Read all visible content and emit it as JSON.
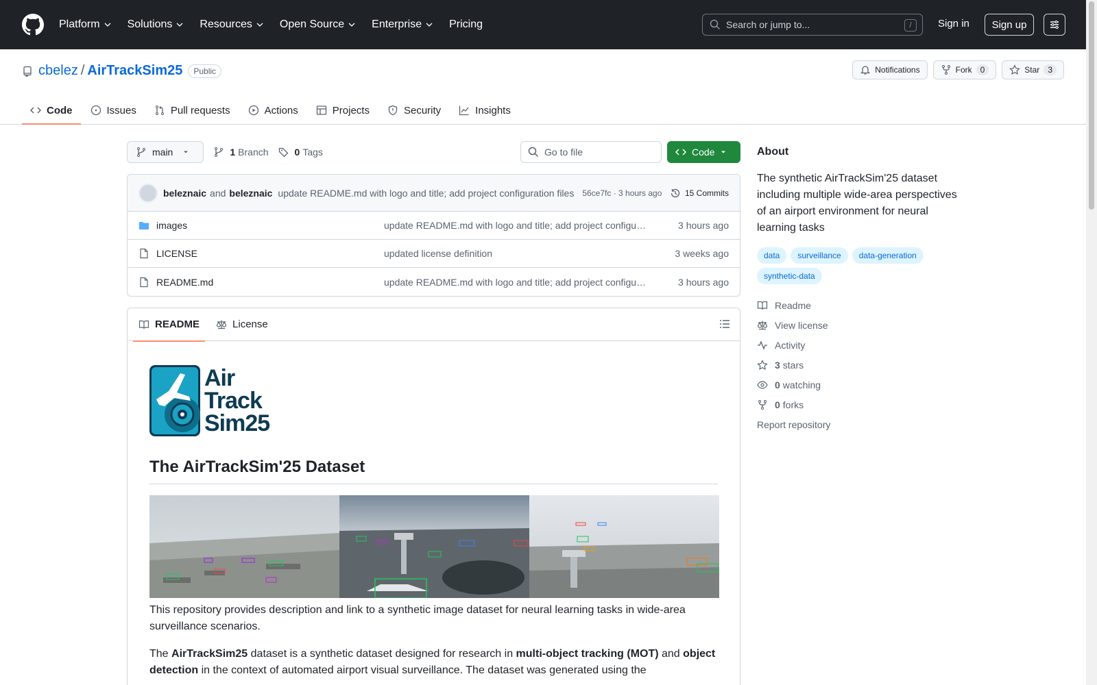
{
  "header": {
    "nav": [
      {
        "label": "Platform",
        "chevron": true
      },
      {
        "label": "Solutions",
        "chevron": true
      },
      {
        "label": "Resources",
        "chevron": true
      },
      {
        "label": "Open Source",
        "chevron": true
      },
      {
        "label": "Enterprise",
        "chevron": true
      },
      {
        "label": "Pricing",
        "chevron": false
      }
    ],
    "search_placeholder": "Search or jump to...",
    "search_shortcut": "/",
    "sign_in": "Sign in",
    "sign_up": "Sign up"
  },
  "repo": {
    "owner": "cbelez",
    "separator": "/",
    "name": "AirTrackSim25",
    "visibility": "Public",
    "notifications_label": "Notifications",
    "fork_label": "Fork",
    "fork_count": "0",
    "star_label": "Star",
    "star_count": "3"
  },
  "tabs": [
    {
      "label": "Code",
      "icon": "code-icon",
      "active": true
    },
    {
      "label": "Issues",
      "icon": "issue-icon",
      "active": false
    },
    {
      "label": "Pull requests",
      "icon": "pull-request-icon",
      "active": false
    },
    {
      "label": "Actions",
      "icon": "play-icon",
      "active": false
    },
    {
      "label": "Projects",
      "icon": "table-icon",
      "active": false
    },
    {
      "label": "Security",
      "icon": "shield-icon",
      "active": false
    },
    {
      "label": "Insights",
      "icon": "graph-icon",
      "active": false
    }
  ],
  "toolbar": {
    "branch": "main",
    "branch_count": "1",
    "branch_label": "Branch",
    "tag_count": "0",
    "tag_label": "Tags",
    "goto_placeholder": "Go to file",
    "code_label": "Code"
  },
  "commit": {
    "author1": "beleznaic",
    "and": "and",
    "author2": "beleznaic",
    "message": "update README.md with logo and title; add project configuration files",
    "sha_time": "56ce7fc · 3 hours ago",
    "commits": "15 Commits"
  },
  "files": [
    {
      "name": "images",
      "type": "folder",
      "message": "update README.md with logo and title; add project configu…",
      "time": "3 hours ago"
    },
    {
      "name": "LICENSE",
      "type": "file",
      "message": "updated license definition",
      "time": "3 weeks ago"
    },
    {
      "name": "README.md",
      "type": "file",
      "message": "update README.md with logo and title; add project configu…",
      "time": "3 hours ago"
    }
  ],
  "readme": {
    "tab_readme": "README",
    "tab_license": "License",
    "logo_line1": "Air",
    "logo_line2": "Track",
    "logo_line3": "Sim25",
    "title": "The AirTrackSim'25 Dataset",
    "p1": "This repository provides description and link to a synthetic image dataset for neural learning tasks in wide-area surveillance scenarios.",
    "p2_a": "The ",
    "p2_b": "AirTrackSim25",
    "p2_c": " dataset is a synthetic dataset designed for research in ",
    "p2_d": "multi-object tracking (MOT)",
    "p2_e": " and ",
    "p2_f": "object detection",
    "p2_g": " in the context of automated airport visual surveillance. The dataset was generated using the"
  },
  "about": {
    "heading": "About",
    "description": "The synthetic AirTrackSim'25 dataset including multiple wide-area perspectives of an airport environment for neural learning tasks",
    "topics": [
      "data",
      "surveillance",
      "data-generation",
      "synthetic-data"
    ],
    "links": [
      {
        "icon": "book-icon",
        "count": "",
        "label": "Readme"
      },
      {
        "icon": "law-icon",
        "count": "",
        "label": "View license"
      },
      {
        "icon": "pulse-icon",
        "count": "",
        "label": "Activity"
      },
      {
        "icon": "star-icon",
        "count": "3",
        "label": "stars"
      },
      {
        "icon": "eye-icon",
        "count": "0",
        "label": "watching"
      },
      {
        "icon": "fork-icon",
        "count": "0",
        "label": "forks"
      }
    ],
    "report": "Report repository"
  },
  "colors": {
    "header_bg": "#1f2328",
    "link": "#0969da",
    "primary_button": "#1f883d",
    "tab_underline": "#fd8c73"
  }
}
